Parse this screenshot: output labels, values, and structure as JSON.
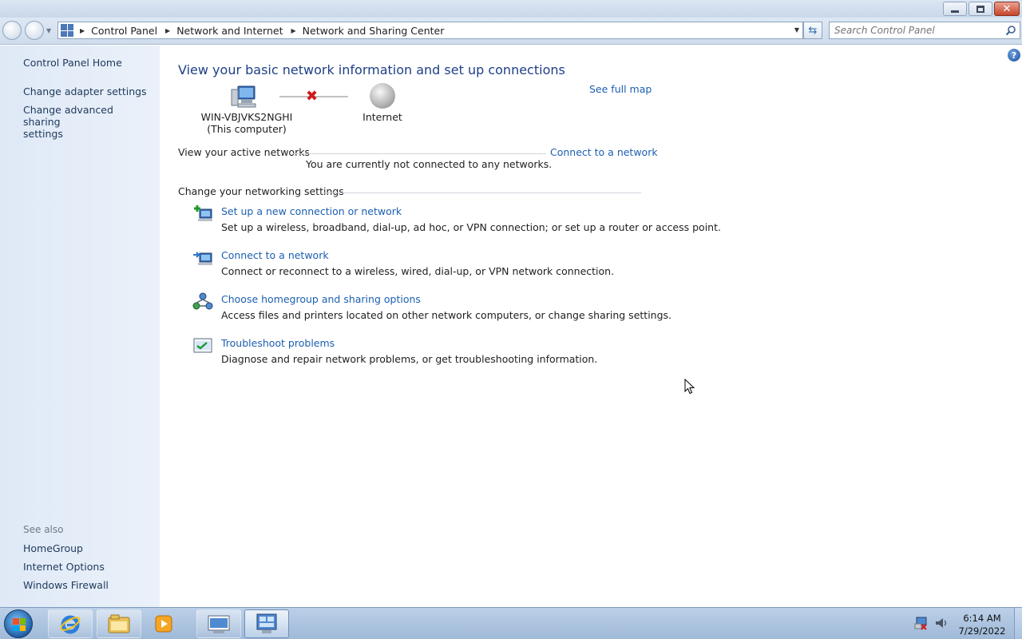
{
  "breadcrumb": [
    "Control Panel",
    "Network and Internet",
    "Network and Sharing Center"
  ],
  "search": {
    "placeholder": "Search Control Panel"
  },
  "left_pane": {
    "links": [
      "Control Panel Home",
      "Change adapter settings",
      "Change advanced sharing\nsettings"
    ],
    "see_also_label": "See also",
    "see_also": [
      "HomeGroup",
      "Internet Options",
      "Windows Firewall"
    ]
  },
  "main": {
    "heading": "View your basic network information and set up connections",
    "see_full_map": "See full map",
    "computer_name": "WIN-VBJVKS2NGHI",
    "computer_sub": "(This computer)",
    "internet_label": "Internet",
    "active_networks_label": "View your active networks",
    "connect_link": "Connect to a network",
    "not_connected": "You are currently not connected to any networks.",
    "settings_label": "Change your networking settings",
    "tasks": [
      {
        "icon": "new-connection-icon",
        "title": "Set up a new connection or network",
        "desc": "Set up a wireless, broadband, dial-up, ad hoc, or VPN connection; or set up a router or access point."
      },
      {
        "icon": "connect-network-icon",
        "title": "Connect to a network",
        "desc": "Connect or reconnect to a wireless, wired, dial-up, or VPN network connection."
      },
      {
        "icon": "homegroup-icon",
        "title": "Choose homegroup and sharing options",
        "desc": "Access files and printers located on other network computers, or change sharing settings."
      },
      {
        "icon": "troubleshoot-icon",
        "title": "Troubleshoot problems",
        "desc": "Diagnose and repair network problems, or get troubleshooting information."
      }
    ]
  },
  "taskbar": {
    "time": "6:14 AM",
    "date": "7/29/2022"
  },
  "colors": {
    "link": "#1c5fb0",
    "heading": "#1e3f86",
    "left_pane": "#dfe9f6"
  }
}
